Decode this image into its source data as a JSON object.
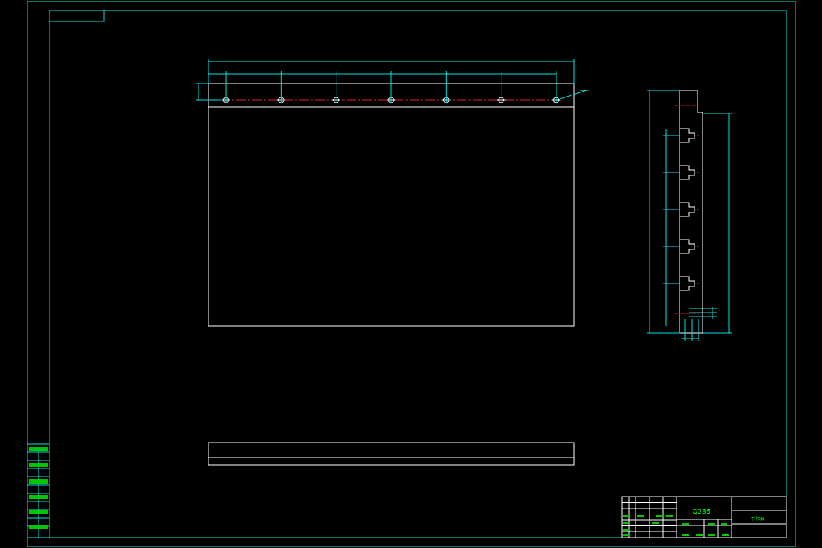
{
  "colors": {
    "background": "#000000",
    "frame": "#00e5e5",
    "outline": "#ffffff",
    "dimension": "#00e5e5",
    "centerline": "#e02020",
    "text": "#00ff00"
  },
  "title_block": {
    "material": "Q235",
    "part_name": "工作台"
  },
  "views": {
    "front_view": {
      "hole_count": 7
    },
    "side_view": {
      "slot_count": 5
    }
  }
}
